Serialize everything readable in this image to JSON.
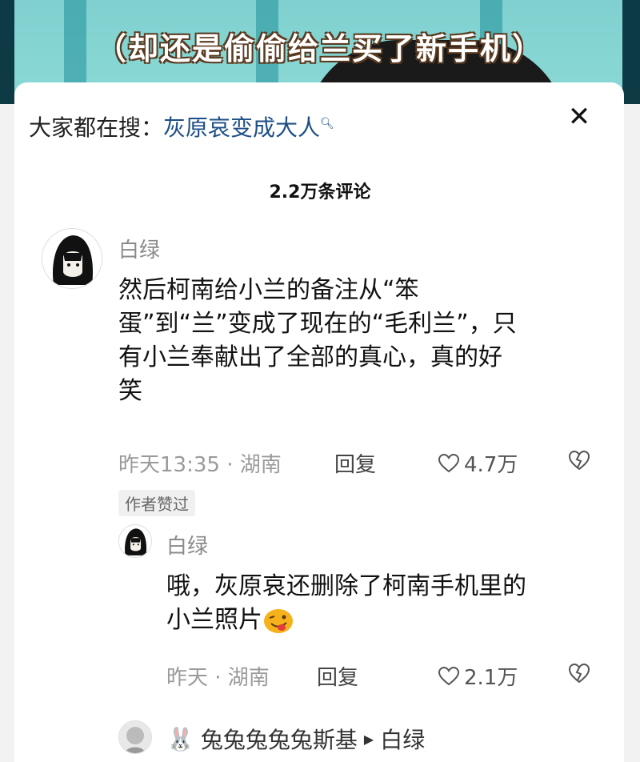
{
  "video": {
    "subtitle": "（却还是偷偷给兰买了新手机）"
  },
  "search": {
    "prefix": "大家都在搜：",
    "term": "灰原哀变成大人",
    "icon": "search-icon"
  },
  "comments_header": {
    "count_label": "2.2万条评论"
  },
  "comments": [
    {
      "username": "白绿",
      "text_lines": [
        "然后柯南给小兰的备注从“笨",
        "蛋”到“兰”变成了现在的“毛利兰”，只",
        "有小兰奉献出了全部的真心，真的好",
        "笑"
      ],
      "meta": "昨天13:35 · 湖南",
      "reply_label": "回复",
      "likes": "4.7万",
      "badge": "作者赞过"
    }
  ],
  "reply": {
    "username": "白绿",
    "text_lines": [
      "哦，灰原哀还删除了柯南手机里的",
      "小兰照片"
    ],
    "emoji": "wink-tongue-emoji",
    "meta": "昨天 · 湖南",
    "reply_label": "回复",
    "likes": "2.1万"
  },
  "next_reply": {
    "emoji": "🐰",
    "username": "兔兔兔兔兔斯基",
    "arrow": "▶",
    "reply_to": "白绿"
  },
  "colors": {
    "link": "#1e4f86",
    "meta": "#9a9a9a",
    "subtitle_outline": "#5a3a20"
  }
}
